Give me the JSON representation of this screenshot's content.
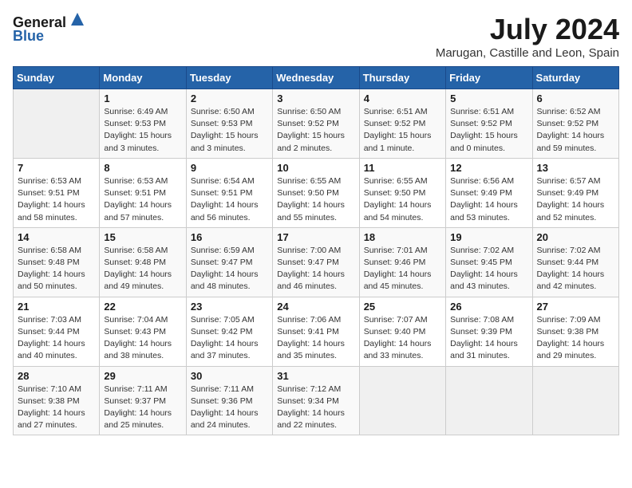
{
  "logo": {
    "general": "General",
    "blue": "Blue"
  },
  "title": {
    "month_year": "July 2024",
    "location": "Marugan, Castille and Leon, Spain"
  },
  "weekdays": [
    "Sunday",
    "Monday",
    "Tuesday",
    "Wednesday",
    "Thursday",
    "Friday",
    "Saturday"
  ],
  "weeks": [
    [
      {
        "day": "",
        "empty": true
      },
      {
        "day": "1",
        "sunrise": "6:49 AM",
        "sunset": "9:53 PM",
        "daylight": "15 hours and 3 minutes."
      },
      {
        "day": "2",
        "sunrise": "6:50 AM",
        "sunset": "9:53 PM",
        "daylight": "15 hours and 3 minutes."
      },
      {
        "day": "3",
        "sunrise": "6:50 AM",
        "sunset": "9:52 PM",
        "daylight": "15 hours and 2 minutes."
      },
      {
        "day": "4",
        "sunrise": "6:51 AM",
        "sunset": "9:52 PM",
        "daylight": "15 hours and 1 minute."
      },
      {
        "day": "5",
        "sunrise": "6:51 AM",
        "sunset": "9:52 PM",
        "daylight": "15 hours and 0 minutes."
      },
      {
        "day": "6",
        "sunrise": "6:52 AM",
        "sunset": "9:52 PM",
        "daylight": "14 hours and 59 minutes."
      }
    ],
    [
      {
        "day": "7",
        "sunrise": "6:53 AM",
        "sunset": "9:51 PM",
        "daylight": "14 hours and 58 minutes."
      },
      {
        "day": "8",
        "sunrise": "6:53 AM",
        "sunset": "9:51 PM",
        "daylight": "14 hours and 57 minutes."
      },
      {
        "day": "9",
        "sunrise": "6:54 AM",
        "sunset": "9:51 PM",
        "daylight": "14 hours and 56 minutes."
      },
      {
        "day": "10",
        "sunrise": "6:55 AM",
        "sunset": "9:50 PM",
        "daylight": "14 hours and 55 minutes."
      },
      {
        "day": "11",
        "sunrise": "6:55 AM",
        "sunset": "9:50 PM",
        "daylight": "14 hours and 54 minutes."
      },
      {
        "day": "12",
        "sunrise": "6:56 AM",
        "sunset": "9:49 PM",
        "daylight": "14 hours and 53 minutes."
      },
      {
        "day": "13",
        "sunrise": "6:57 AM",
        "sunset": "9:49 PM",
        "daylight": "14 hours and 52 minutes."
      }
    ],
    [
      {
        "day": "14",
        "sunrise": "6:58 AM",
        "sunset": "9:48 PM",
        "daylight": "14 hours and 50 minutes."
      },
      {
        "day": "15",
        "sunrise": "6:58 AM",
        "sunset": "9:48 PM",
        "daylight": "14 hours and 49 minutes."
      },
      {
        "day": "16",
        "sunrise": "6:59 AM",
        "sunset": "9:47 PM",
        "daylight": "14 hours and 48 minutes."
      },
      {
        "day": "17",
        "sunrise": "7:00 AM",
        "sunset": "9:47 PM",
        "daylight": "14 hours and 46 minutes."
      },
      {
        "day": "18",
        "sunrise": "7:01 AM",
        "sunset": "9:46 PM",
        "daylight": "14 hours and 45 minutes."
      },
      {
        "day": "19",
        "sunrise": "7:02 AM",
        "sunset": "9:45 PM",
        "daylight": "14 hours and 43 minutes."
      },
      {
        "day": "20",
        "sunrise": "7:02 AM",
        "sunset": "9:44 PM",
        "daylight": "14 hours and 42 minutes."
      }
    ],
    [
      {
        "day": "21",
        "sunrise": "7:03 AM",
        "sunset": "9:44 PM",
        "daylight": "14 hours and 40 minutes."
      },
      {
        "day": "22",
        "sunrise": "7:04 AM",
        "sunset": "9:43 PM",
        "daylight": "14 hours and 38 minutes."
      },
      {
        "day": "23",
        "sunrise": "7:05 AM",
        "sunset": "9:42 PM",
        "daylight": "14 hours and 37 minutes."
      },
      {
        "day": "24",
        "sunrise": "7:06 AM",
        "sunset": "9:41 PM",
        "daylight": "14 hours and 35 minutes."
      },
      {
        "day": "25",
        "sunrise": "7:07 AM",
        "sunset": "9:40 PM",
        "daylight": "14 hours and 33 minutes."
      },
      {
        "day": "26",
        "sunrise": "7:08 AM",
        "sunset": "9:39 PM",
        "daylight": "14 hours and 31 minutes."
      },
      {
        "day": "27",
        "sunrise": "7:09 AM",
        "sunset": "9:38 PM",
        "daylight": "14 hours and 29 minutes."
      }
    ],
    [
      {
        "day": "28",
        "sunrise": "7:10 AM",
        "sunset": "9:38 PM",
        "daylight": "14 hours and 27 minutes."
      },
      {
        "day": "29",
        "sunrise": "7:11 AM",
        "sunset": "9:37 PM",
        "daylight": "14 hours and 25 minutes."
      },
      {
        "day": "30",
        "sunrise": "7:11 AM",
        "sunset": "9:36 PM",
        "daylight": "14 hours and 24 minutes."
      },
      {
        "day": "31",
        "sunrise": "7:12 AM",
        "sunset": "9:34 PM",
        "daylight": "14 hours and 22 minutes."
      },
      {
        "day": "",
        "empty": true
      },
      {
        "day": "",
        "empty": true
      },
      {
        "day": "",
        "empty": true
      }
    ]
  ],
  "labels": {
    "sunrise": "Sunrise:",
    "sunset": "Sunset:",
    "daylight": "Daylight:"
  }
}
